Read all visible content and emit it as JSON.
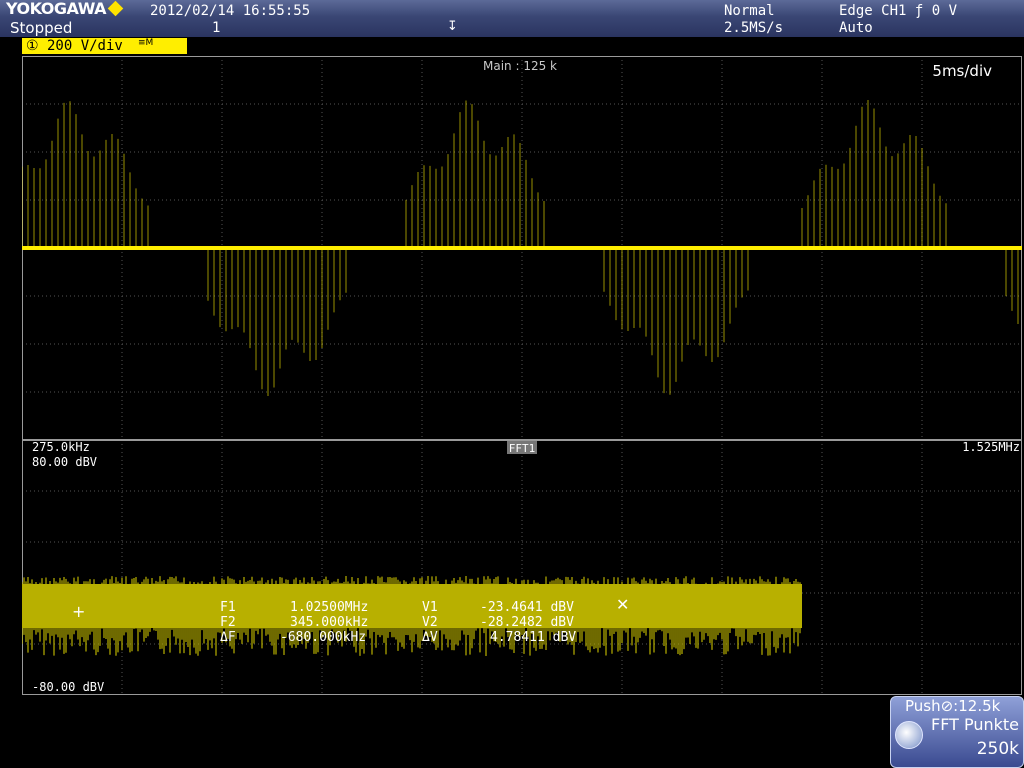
{
  "header": {
    "brand": "YOKOGAWA",
    "state": "Stopped",
    "datetime": "2012/02/14 16:55:55",
    "acq_count": "1",
    "acq_mode": "Normal",
    "sample_rate": "2.5MS/s",
    "trigger": "Edge CH1 ƒ 0 V",
    "trigger_mode": "Auto"
  },
  "channel": {
    "label": "① 200 V/div",
    "color": "#ffee00"
  },
  "waveform": {
    "record": "Main : 125 k",
    "timebase": "5ms/div",
    "color": "#ffee00",
    "cycles": 3,
    "period_div": 5
  },
  "fft": {
    "start_freq": "275.0kHz",
    "stop_freq": "1.525MHz",
    "top_level": "80.00 dBV",
    "bottom_level": "-80.00 dBV",
    "label": "FFT1",
    "color": "#b8b000"
  },
  "cursors": {
    "F1": {
      "label": "F1",
      "value": "1.02500MHz"
    },
    "F2": {
      "label": "F2",
      "value": "345.000kHz"
    },
    "dF": {
      "label": "ΔF",
      "value": "-680.000kHz"
    },
    "V1": {
      "label": "V1",
      "value": "-23.4641 dBV"
    },
    "V2": {
      "label": "V2",
      "value": "-28.2482 dBV"
    },
    "dV": {
      "label": "ΔV",
      "value": "4.78411 dBV"
    }
  },
  "knob": {
    "push_label": "Push⊘:12.5k",
    "title": "FFT Punkte",
    "value": "250k"
  }
}
